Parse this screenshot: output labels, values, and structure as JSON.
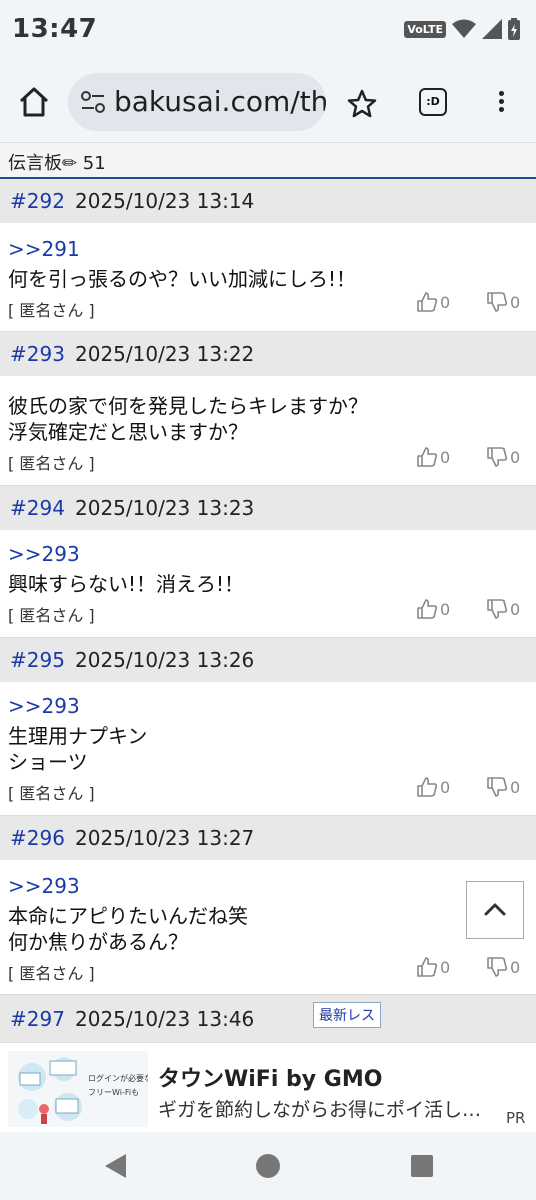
{
  "status": {
    "time": "13:47",
    "volte": "VoLTE"
  },
  "browser": {
    "url": "bakusai.com/th"
  },
  "board": {
    "title": "伝言板✏ 51"
  },
  "posts": [
    {
      "num": "#292",
      "date": "2025/10/23 13:14",
      "reply": ">>291",
      "lines": [
        "何を引っ張るのや？いい加減にしろ!！"
      ],
      "author": "[ 匿名さん ]",
      "likes": "0",
      "dislikes": "0"
    },
    {
      "num": "#293",
      "date": "2025/10/23 13:22",
      "reply": "",
      "lines": [
        "彼氏の家で何を発見したらキレますか？",
        "浮気確定だと思いますか？"
      ],
      "author": "[ 匿名さん ]",
      "likes": "0",
      "dislikes": "0"
    },
    {
      "num": "#294",
      "date": "2025/10/23 13:23",
      "reply": ">>293",
      "lines": [
        "興味すらない!！消えろ!！"
      ],
      "author": "[ 匿名さん ]",
      "likes": "0",
      "dislikes": "0"
    },
    {
      "num": "#295",
      "date": "2025/10/23 13:26",
      "reply": ">>293",
      "lines": [
        "生理用ナプキン",
        "ショーツ"
      ],
      "author": "[ 匿名さん ]",
      "likes": "0",
      "dislikes": "0"
    },
    {
      "num": "#296",
      "date": "2025/10/23 13:27",
      "reply": ">>293",
      "lines": [
        "本命にアピりたいんだね笑",
        "何か焦りがあるん？"
      ],
      "author": "[ 匿名さん ]",
      "likes": "0",
      "dislikes": "0"
    },
    {
      "num": "#297",
      "date": "2025/10/23 13:46",
      "badge": "最新レス"
    }
  ],
  "ad": {
    "title": "タウンWiFi by GMO",
    "subtitle": "ギガを節約しながらお得にポイ活し…",
    "label": "PR",
    "image_text_1": "ログインが必要な",
    "image_text_2": "フリーWi-Fiも"
  },
  "colors": {
    "link": "#1a3aa8",
    "header_bar": "#1f4e8c",
    "post_header_bg": "#e8e8e8"
  },
  "icons": [
    "home-icon",
    "tune-icon",
    "star-icon",
    "tab-switcher-icon",
    "more-vert-icon",
    "thumbs-up-icon",
    "thumbs-down-icon",
    "chevron-up-icon",
    "back-icon",
    "home-circle-icon",
    "recents-icon"
  ]
}
